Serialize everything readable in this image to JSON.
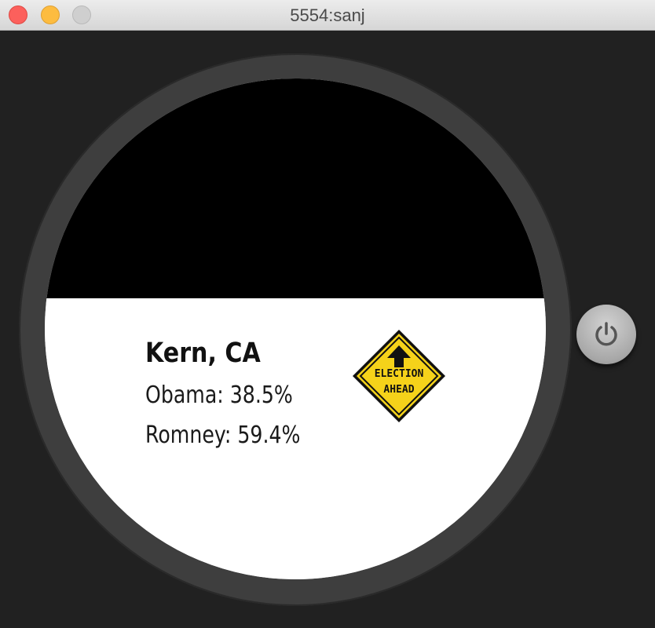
{
  "window": {
    "title": "5554:sanj"
  },
  "watch_face": {
    "county": "Kern, CA",
    "results": {
      "obama": "Obama: 38.5%",
      "romney": "Romney: 59.4%"
    },
    "sign": {
      "line1": "ELECTION",
      "line2": "AHEAD",
      "icon": "election-ahead-sign-icon",
      "color": "#f5d21a"
    },
    "top_color": "#000000",
    "bottom_color": "#ffffff"
  },
  "controls": {
    "power_icon": "power-icon"
  }
}
